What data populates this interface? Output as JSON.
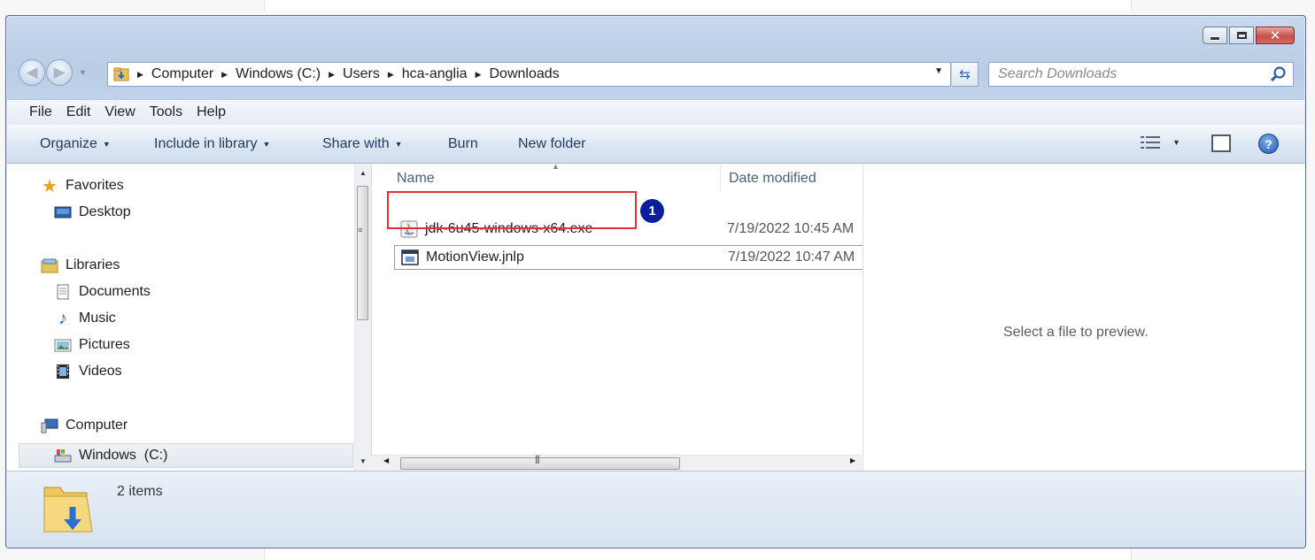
{
  "window": {
    "address": {
      "crumbs": [
        "Computer",
        "Windows (C:)",
        "Users",
        "hca-anglia",
        "Downloads"
      ]
    },
    "search": {
      "placeholder": "Search Downloads"
    }
  },
  "menubar": {
    "items": [
      "File",
      "Edit",
      "View",
      "Tools",
      "Help"
    ]
  },
  "toolbar": {
    "organize": "Organize",
    "include_in_library": "Include in library",
    "share_with": "Share with",
    "burn": "Burn",
    "new_folder": "New folder"
  },
  "nav_pane": {
    "favorites": {
      "label": "Favorites",
      "items": [
        {
          "label": "Desktop",
          "icon": "desktop-icon"
        }
      ]
    },
    "libraries": {
      "label": "Libraries",
      "items": [
        {
          "label": "Documents",
          "icon": "documents-icon"
        },
        {
          "label": "Music",
          "icon": "music-icon"
        },
        {
          "label": "Pictures",
          "icon": "pictures-icon"
        },
        {
          "label": "Videos",
          "icon": "videos-icon"
        }
      ]
    },
    "computer": {
      "label": "Computer",
      "items": [
        {
          "label": "Windows  (C:)",
          "icon": "drive-icon",
          "selected": true
        }
      ]
    }
  },
  "file_list": {
    "columns": {
      "name": "Name",
      "date": "Date modified"
    },
    "rows": [
      {
        "name": "jdk-6u45-windows-x64.exe",
        "date": "7/19/2022 10:45 AM",
        "icon": "java-installer-icon"
      },
      {
        "name": "MotionView.jnlp",
        "date": "7/19/2022 10:47 AM",
        "icon": "jnlp-icon"
      }
    ]
  },
  "preview": {
    "message": "Select a file to preview."
  },
  "status": {
    "count": "2 items"
  },
  "annotation": {
    "number": "1",
    "color": "#e0303a",
    "badge_color": "#0b1e9c"
  }
}
